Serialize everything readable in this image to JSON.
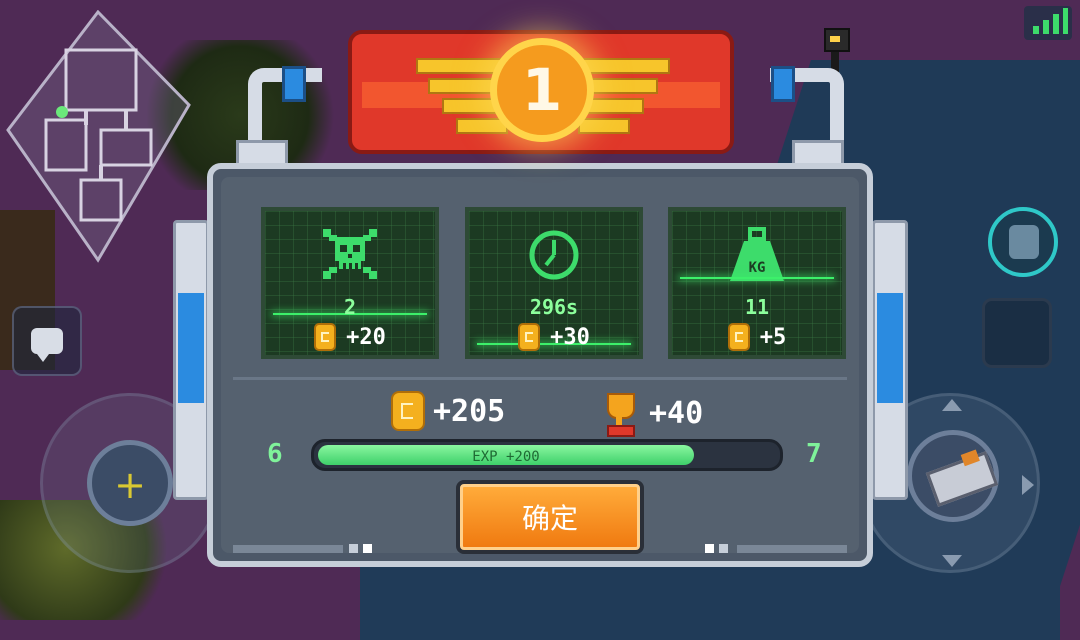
{
  "rank": {
    "number": "1"
  },
  "stats": [
    {
      "id": "kills",
      "icon": "skull-crossbones-icon",
      "value": "2",
      "reward": "+20"
    },
    {
      "id": "time",
      "icon": "clock-icon",
      "value": "296s",
      "reward": "+30"
    },
    {
      "id": "weight",
      "icon": "kg-weight-icon",
      "icon_text": "KG",
      "value": "11",
      "reward": "+5"
    }
  ],
  "totals": {
    "coins": "+205",
    "trophies": "+40"
  },
  "experience": {
    "level_current": "6",
    "level_next": "7",
    "label": "EXP +200",
    "fill_fraction": 0.82
  },
  "confirm": {
    "label": "确定"
  },
  "colors": {
    "accent_green": "#3ddc6b",
    "banner_red": "#e0382a",
    "medal_orange": "#f59b1e",
    "button_orange": "#f58a1a"
  }
}
